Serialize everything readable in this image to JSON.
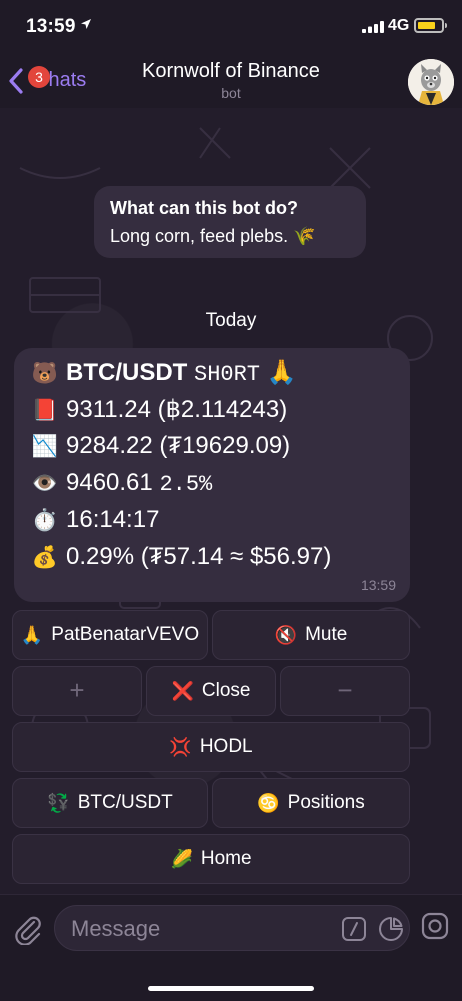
{
  "status": {
    "time": "13:59",
    "network": "4G",
    "battery_level": 0.8,
    "icons": [
      "location-arrow-icon",
      "signal-icon",
      "battery-icon"
    ]
  },
  "header": {
    "back_label": "Chats",
    "unread_badge": "3",
    "title": "Kornwolf of Binance",
    "subtitle": "bot"
  },
  "bot_info": {
    "heading": "What can this bot do?",
    "text": "Long corn, feed plebs. 🌾"
  },
  "date_separator": "Today",
  "message": {
    "lines": [
      {
        "emoji": "🐻",
        "pair": "BTC/USDT",
        "mono": "SH0RT",
        "tail": "🙏"
      },
      {
        "emoji": "📕",
        "text": "9311.24 (฿2.114243)"
      },
      {
        "emoji": "📉",
        "text": "9284.22 (₮19629.09)"
      },
      {
        "emoji": "👁️",
        "text": "9460.61",
        "mono": "2.5%"
      },
      {
        "emoji": "⏱️",
        "text": "16:14:17"
      },
      {
        "emoji": "💰",
        "text": "0.29% (₮57.14 ≈ $56.97)"
      }
    ],
    "timestamp": "13:59"
  },
  "keyboard": {
    "patbenatar": {
      "icon": "🙏",
      "label": "PatBenatarVEVO"
    },
    "mute": {
      "icon": "🔇",
      "label": "Mute"
    },
    "plus": "+",
    "close": {
      "icon": "❌",
      "label": "Close"
    },
    "minus": "−",
    "hodl": {
      "icon": "💢",
      "label": "HODL"
    },
    "pair": {
      "icon": "💱",
      "label": "BTC/USDT"
    },
    "positions": {
      "icon": "♋",
      "label": "Positions"
    },
    "home": {
      "icon": "🌽",
      "label": "Home"
    }
  },
  "composer": {
    "placeholder": "Message"
  },
  "colors": {
    "accent": "#9b7cf0",
    "background": "#231d2b",
    "bubble": "#352d3f",
    "badge": "#e2453c",
    "battery": "#f9d21b"
  }
}
